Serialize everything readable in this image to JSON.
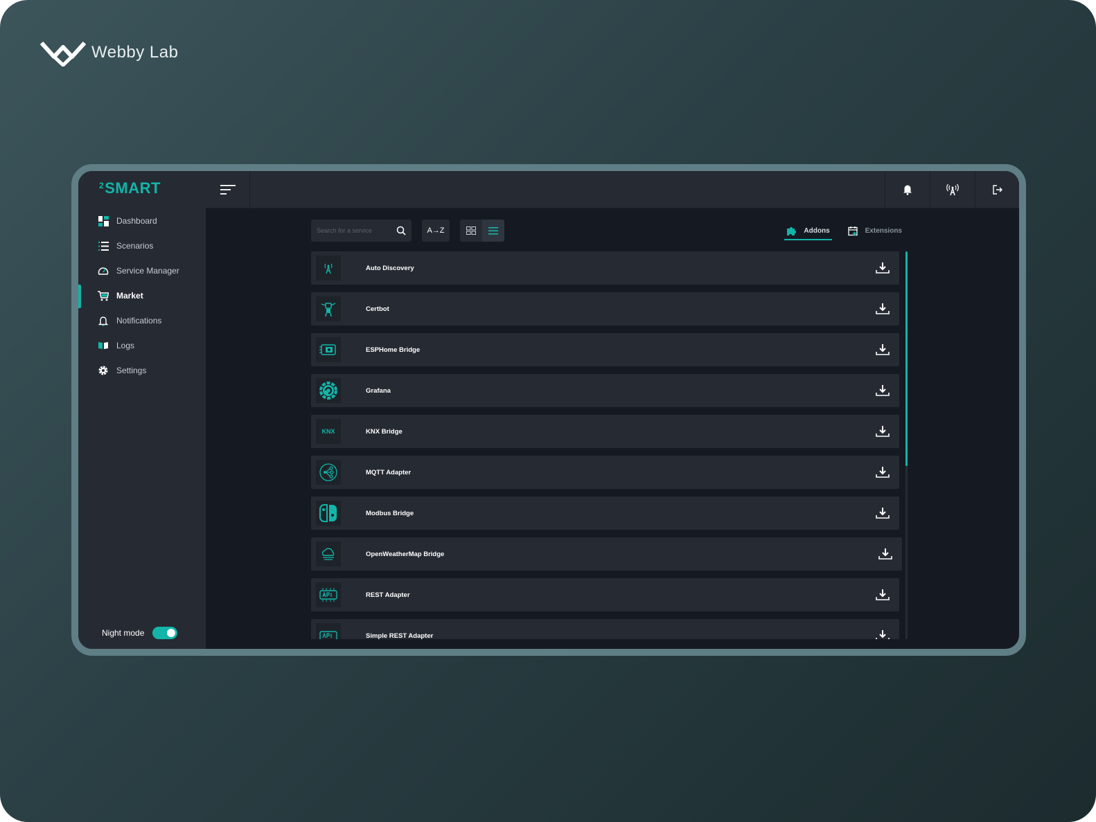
{
  "brand": {
    "name": "Webby Lab"
  },
  "app": {
    "logo_sup": "2",
    "logo_text": "SMART"
  },
  "sidebar": {
    "items": [
      {
        "label": "Dashboard",
        "icon": "dashboard-icon"
      },
      {
        "label": "Scenarios",
        "icon": "list-icon"
      },
      {
        "label": "Service Manager",
        "icon": "gauge-icon"
      },
      {
        "label": "Market",
        "icon": "cart-icon",
        "active": true
      },
      {
        "label": "Notifications",
        "icon": "bell-icon"
      },
      {
        "label": "Logs",
        "icon": "book-icon"
      },
      {
        "label": "Settings",
        "icon": "gear-icon"
      }
    ],
    "night_mode": {
      "label": "Night mode",
      "on": true
    }
  },
  "toolbar": {
    "search_placeholder": "Search for a service",
    "sort_label": "A→Z",
    "view": "list"
  },
  "tabs": [
    {
      "label": "Addons",
      "icon": "puzzle-icon",
      "active": true
    },
    {
      "label": "Extensions",
      "icon": "calendar-star-icon",
      "active": false
    }
  ],
  "services": [
    {
      "name": "Auto Discovery",
      "icon": "antenna-icon"
    },
    {
      "name": "Certbot",
      "icon": "robot-icon"
    },
    {
      "name": "ESPHome Bridge",
      "icon": "chip-icon"
    },
    {
      "name": "Grafana",
      "icon": "grafana-icon"
    },
    {
      "name": "KNX Bridge",
      "icon": "knx-icon",
      "icon_text": "KNX"
    },
    {
      "name": "MQTT Adapter",
      "icon": "network-icon"
    },
    {
      "name": "Modbus Bridge",
      "icon": "switch-icon"
    },
    {
      "name": "OpenWeatherMap Bridge",
      "icon": "cloud-icon"
    },
    {
      "name": "REST Adapter",
      "icon": "api-icon"
    },
    {
      "name": "Simple REST Adapter",
      "icon": "api-icon"
    }
  ],
  "colors": {
    "accent": "#12b5a8",
    "panel": "#262b33",
    "content_bg": "#151a22",
    "frame": "#5f7e86"
  }
}
